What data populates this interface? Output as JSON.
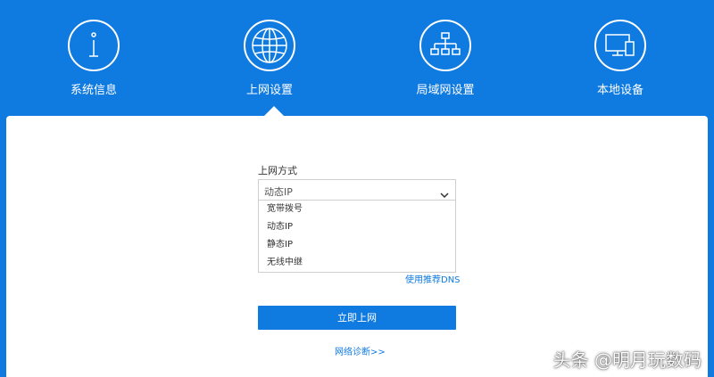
{
  "colors": {
    "brand": "#0f7ae0",
    "panel": "#ffffff",
    "text": "#333333"
  },
  "nav": {
    "items": [
      {
        "label": "系统信息",
        "icon": "info-icon"
      },
      {
        "label": "上网设置",
        "icon": "globe-icon",
        "active": true
      },
      {
        "label": "局域网设置",
        "icon": "network-tree-icon"
      },
      {
        "label": "本地设备",
        "icon": "devices-icon"
      }
    ]
  },
  "wan": {
    "field_label": "上网方式",
    "selected": "动态IP",
    "options": [
      "宽带拨号",
      "动态IP",
      "静态IP",
      "无线中继"
    ],
    "dns_link": "使用推荐DNS",
    "connect_button": "立即上网",
    "diagnose_link": "网络诊断>>"
  },
  "watermark": "头条 @明月玩数码"
}
